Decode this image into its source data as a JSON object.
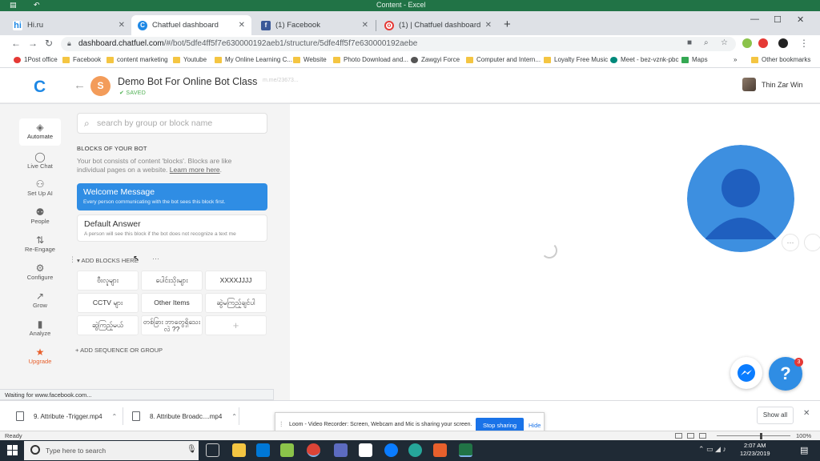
{
  "excel": {
    "title": "Content - Excel",
    "status_ready": "Ready",
    "zoom": "100%",
    "zoom_fraction": 0.6
  },
  "browser": {
    "tabs": [
      {
        "label": "Hi.ru",
        "favicon": "hi",
        "color": "#1e88e5",
        "active": false
      },
      {
        "label": "Chatfuel dashboard",
        "favicon": "C",
        "color": "#1e88e5",
        "active": true
      },
      {
        "label": "(1) Facebook",
        "favicon": "f",
        "color": "#3b5998",
        "active": false
      },
      {
        "label": "(1) | Chatfuel dashboard",
        "favicon": "o",
        "color": "#e53935",
        "active": false
      }
    ],
    "url_host": "dashboard.chatfuel.com",
    "url_path": "/#/bot/5dfe4ff5f7e630000192aeb1/structure/5dfe4ff5f7e630000192aebe",
    "bookmarks": [
      {
        "label": "1Post office",
        "color": "#e53935"
      },
      {
        "label": "Facebook",
        "color": "#f4c542"
      },
      {
        "label": "content marketing",
        "color": "#f4c542"
      },
      {
        "label": "Youtube",
        "color": "#f4c542"
      },
      {
        "label": "My Online Learning C...",
        "color": "#f4c542"
      },
      {
        "label": "Website",
        "color": "#f4c542"
      },
      {
        "label": "Photo Download and...",
        "color": "#f4c542"
      },
      {
        "label": "Zawgyi Force",
        "color": "#555555"
      },
      {
        "label": "Computer and Intern...",
        "color": "#f4c542"
      },
      {
        "label": "Loyalty Free Music",
        "color": "#f4c542"
      },
      {
        "label": "Meet - bez-vznk-pbc",
        "color": "#00897b"
      },
      {
        "label": "Maps",
        "color": "#34a853"
      }
    ],
    "bookmarks_more": "»",
    "other_bookmarks": "Other bookmarks",
    "status_tip": "Waiting for www.facebook.com..."
  },
  "app": {
    "bot_initial": "S",
    "bot_name": "Demo Bot For Online Bot Class",
    "saved": "SAVED",
    "msm_link": "m.me/23673...",
    "user_name": "Thin Zar Win",
    "nav": [
      {
        "label": "Automate",
        "icon": "automate-icon",
        "glyph": "◈"
      },
      {
        "label": "Live Chat",
        "icon": "chat-icon",
        "glyph": "◯"
      },
      {
        "label": "Set Up AI",
        "icon": "ai-icon",
        "glyph": "⚇"
      },
      {
        "label": "People",
        "icon": "people-icon",
        "glyph": "⚉"
      },
      {
        "label": "Re-Engage",
        "icon": "reengage-icon",
        "glyph": "⇅"
      },
      {
        "label": "Configure",
        "icon": "gear-icon",
        "glyph": "⚙"
      },
      {
        "label": "Grow",
        "icon": "grow-icon",
        "glyph": "↗"
      },
      {
        "label": "Analyze",
        "icon": "chart-icon",
        "glyph": "▮"
      },
      {
        "label": "Upgrade",
        "icon": "star-icon",
        "glyph": "★"
      }
    ],
    "search_placeholder": "search by group or block name",
    "blocks_title": "BLOCKS OF YOUR BOT",
    "blocks_desc": "Your bot consists of content 'blocks'. Blocks are like individual pages on a website.",
    "learn_more": "Learn more here",
    "welcome_title": "Welcome Message",
    "welcome_sub": "Every person communicating with the bot sees this block first.",
    "default_title": "Default Answer",
    "default_sub": "A person will see this block if the bot does not recognize a text me",
    "add_blocks": "ADD BLOCKS HERE",
    "more": "···",
    "blocks": [
      "ဗီးလူများ",
      "ပေါင်းသိုးများ",
      "XXXXJJJJ",
      "CCTV များ",
      "Other Items",
      "ဆွဲမကြည့်ချင်ပါ",
      "ဆွဲကြည့်မယ်",
      "တစ်ခြား ဘာတွေရှိသေးလဲ ??",
      "+"
    ],
    "add_sequence": "ADD SEQUENCE OR GROUP",
    "help": "?",
    "help_badge": "3"
  },
  "downloads": {
    "items": [
      {
        "label": "9. Attribute -Trigger.mp4"
      },
      {
        "label": "8. Attribute Broadc....mp4"
      }
    ],
    "show_all": "Show all"
  },
  "loom": {
    "text": "Loom - Video Recorder: Screen, Webcam and Mic is sharing your screen.",
    "stop": "Stop sharing",
    "hide": "Hide"
  },
  "taskbar": {
    "search_placeholder": "Type here to search",
    "time": "2:07 AM",
    "date": "12/23/2019"
  }
}
